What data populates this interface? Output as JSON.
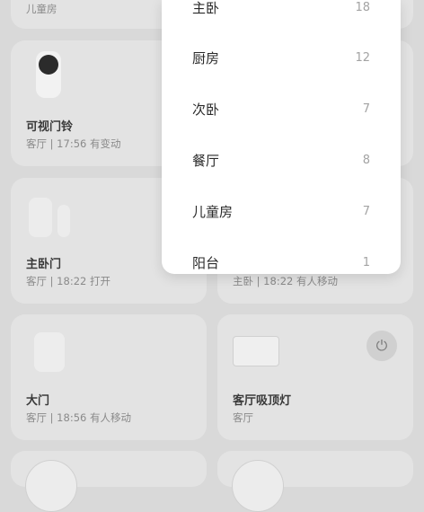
{
  "top_card": {
    "title": "儿童房"
  },
  "devices": [
    {
      "id": "doorbell",
      "title": "可视门铃",
      "sub": "客厅 | 17:56 有变动"
    },
    {
      "id": "master-door",
      "title": "主卧门",
      "sub": "客厅 | 18:22 打开"
    },
    {
      "id": "hidden-sensor",
      "title": "",
      "sub": "主卧 | 18:22 有人移动"
    },
    {
      "id": "main-door",
      "title": "大门",
      "sub": "客厅 | 18:56 有人移动"
    },
    {
      "id": "ceiling-light",
      "title": "客厅吸顶灯",
      "sub": "客厅"
    }
  ],
  "room_dropdown": {
    "items": [
      {
        "name": "主卧",
        "count": "18"
      },
      {
        "name": "厨房",
        "count": "12"
      },
      {
        "name": "次卧",
        "count": "7"
      },
      {
        "name": "餐厅",
        "count": "8"
      },
      {
        "name": "儿童房",
        "count": "7"
      },
      {
        "name": "阳台",
        "count": "1"
      }
    ]
  },
  "icons": {
    "power": "power-icon"
  },
  "colors": {
    "overlay_bg": "#d9d9d9",
    "card_bg": "#e3e3e3",
    "dropdown_bg": "#ffffff"
  }
}
